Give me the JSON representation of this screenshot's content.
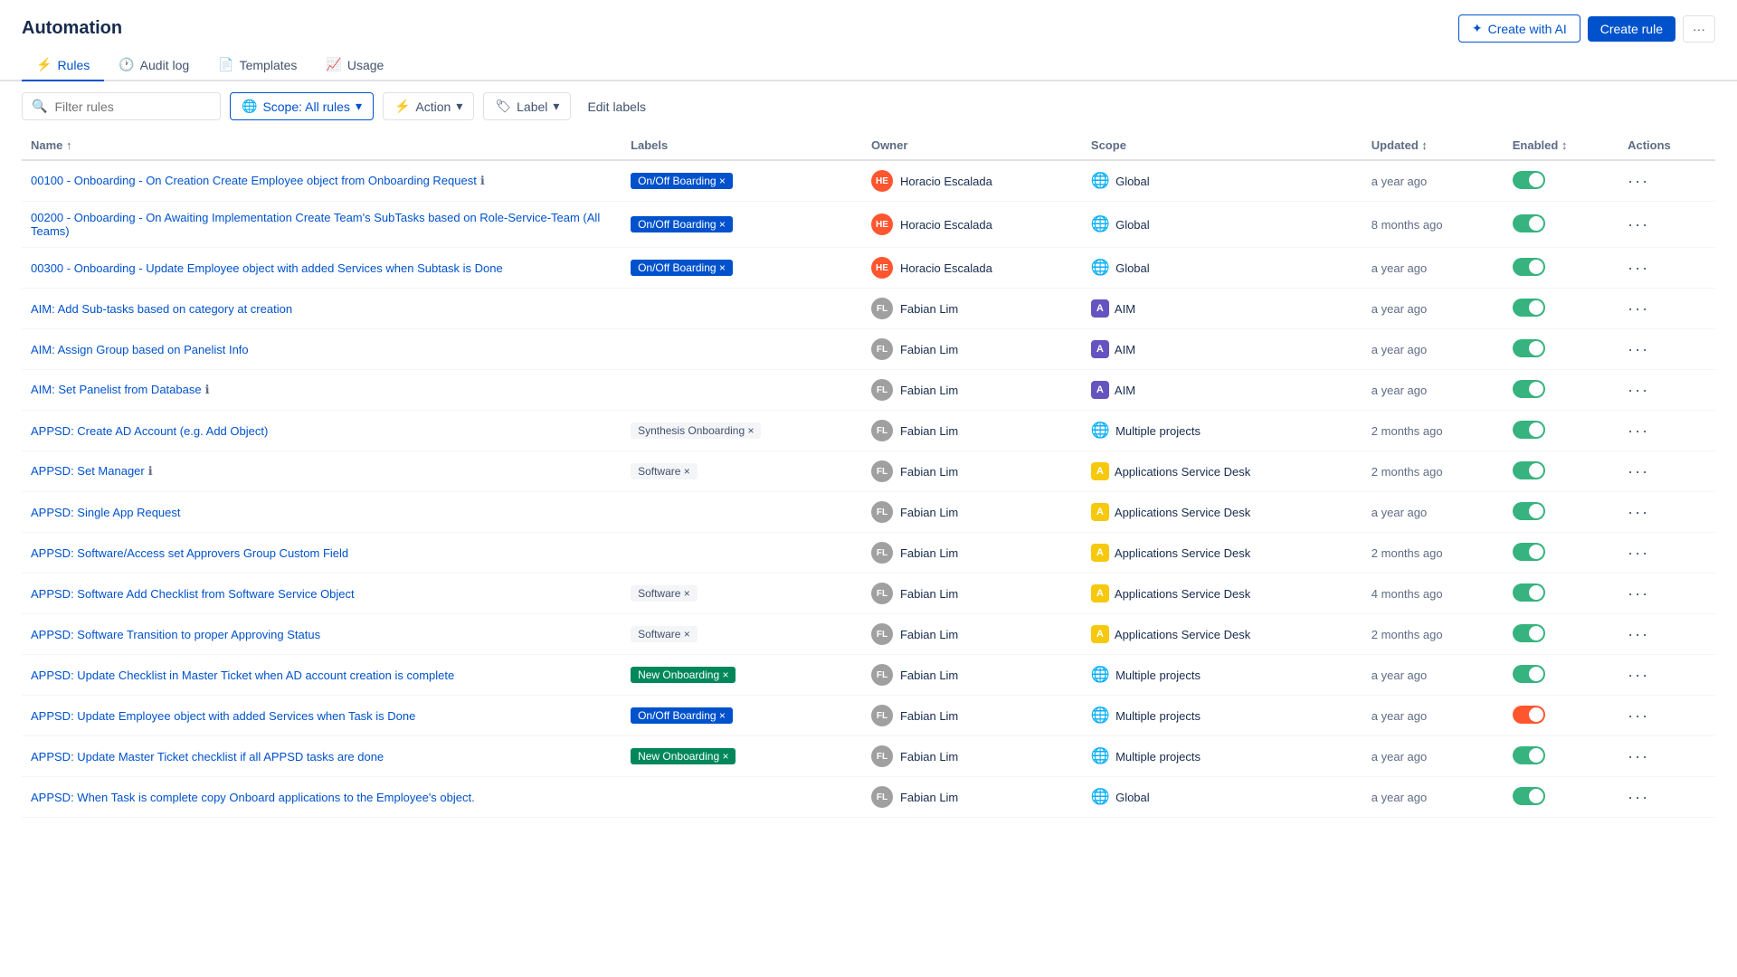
{
  "header": {
    "title": "Automation",
    "btn_create_ai": "Create with AI",
    "btn_create_rule": "Create rule",
    "btn_more_label": "···"
  },
  "tabs": [
    {
      "id": "rules",
      "label": "Rules",
      "icon": "⚡",
      "active": true
    },
    {
      "id": "audit-log",
      "label": "Audit log",
      "icon": "📋",
      "active": false
    },
    {
      "id": "templates",
      "label": "Templates",
      "icon": "📄",
      "active": false
    },
    {
      "id": "usage",
      "label": "Usage",
      "icon": "📈",
      "active": false
    }
  ],
  "toolbar": {
    "search_placeholder": "Filter rules",
    "scope_btn": "Scope: All rules",
    "action_btn": "Action",
    "label_btn": "Label",
    "edit_labels_btn": "Edit labels"
  },
  "table": {
    "columns": [
      "Name ↑",
      "Labels",
      "Owner",
      "Scope",
      "Updated ↕",
      "Enabled ↕",
      "Actions"
    ],
    "rows": [
      {
        "name": "00100 - Onboarding - On Creation Create Employee object from Onboarding Request",
        "note": "ℹ",
        "labels": [
          {
            "text": "On/Off Boarding ×",
            "type": "onoffboarding"
          }
        ],
        "owner_initials": "HE",
        "owner_name": "Horacio Escalada",
        "owner_type": "he",
        "scope_icon": "🌐",
        "scope": "Global",
        "updated": "a year ago",
        "enabled": true,
        "toggle_type": "on"
      },
      {
        "name": "00200 - Onboarding - On Awaiting Implementation Create Team's SubTasks based on Role-Service-Team (All Teams)",
        "note": "",
        "labels": [
          {
            "text": "On/Off Boarding ×",
            "type": "onoffboarding"
          }
        ],
        "owner_initials": "HE",
        "owner_name": "Horacio Escalada",
        "owner_type": "he",
        "scope_icon": "🌐",
        "scope": "Global",
        "updated": "8 months ago",
        "enabled": true,
        "toggle_type": "on"
      },
      {
        "name": "00300 - Onboarding - Update Employee object with added Services when Subtask is Done",
        "note": "",
        "labels": [
          {
            "text": "On/Off Boarding ×",
            "type": "onoffboarding"
          }
        ],
        "owner_initials": "HE",
        "owner_name": "Horacio Escalada",
        "owner_type": "he",
        "scope_icon": "🌐",
        "scope": "Global",
        "updated": "a year ago",
        "enabled": true,
        "toggle_type": "on"
      },
      {
        "name": "AIM: Add Sub-tasks based on category at creation",
        "note": "",
        "labels": [],
        "owner_initials": "FL",
        "owner_name": "Fabian Lim",
        "owner_type": "fl",
        "scope_icon": "🎯",
        "scope": "AIM",
        "updated": "a year ago",
        "enabled": true,
        "toggle_type": "on"
      },
      {
        "name": "AIM: Assign Group based on Panelist Info",
        "note": "",
        "labels": [],
        "owner_initials": "FL",
        "owner_name": "Fabian Lim",
        "owner_type": "fl",
        "scope_icon": "🎯",
        "scope": "AIM",
        "updated": "a year ago",
        "enabled": true,
        "toggle_type": "on"
      },
      {
        "name": "AIM: Set Panelist from Database",
        "note": "ℹ",
        "labels": [],
        "owner_initials": "FL",
        "owner_name": "Fabian Lim",
        "owner_type": "fl",
        "scope_icon": "🎯",
        "scope": "AIM",
        "updated": "a year ago",
        "enabled": true,
        "toggle_type": "on"
      },
      {
        "name": "APPSD: Create AD Account (e.g. Add Object)",
        "note": "",
        "labels": [
          {
            "text": "Synthesis Onboarding ×",
            "type": "synthesis"
          }
        ],
        "owner_initials": "FL",
        "owner_name": "Fabian Lim",
        "owner_type": "fl",
        "scope_icon": "🌐",
        "scope": "Multiple projects",
        "updated": "2 months ago",
        "enabled": true,
        "toggle_type": "on"
      },
      {
        "name": "APPSD: Set Manager",
        "note": "ℹ",
        "labels": [
          {
            "text": "Software ×",
            "type": "software"
          }
        ],
        "owner_initials": "FL",
        "owner_name": "Fabian Lim",
        "owner_type": "fl",
        "scope_icon": "🟡",
        "scope": "Applications Service Desk",
        "updated": "2 months ago",
        "enabled": true,
        "toggle_type": "on"
      },
      {
        "name": "APPSD: Single App Request",
        "note": "",
        "labels": [],
        "owner_initials": "FL",
        "owner_name": "Fabian Lim",
        "owner_type": "fl",
        "scope_icon": "🟡",
        "scope": "Applications Service Desk",
        "updated": "a year ago",
        "enabled": true,
        "toggle_type": "on"
      },
      {
        "name": "APPSD: Software/Access set Approvers Group Custom Field",
        "note": "",
        "labels": [],
        "owner_initials": "FL",
        "owner_name": "Fabian Lim",
        "owner_type": "fl",
        "scope_icon": "🟡",
        "scope": "Applications Service Desk",
        "updated": "2 months ago",
        "enabled": true,
        "toggle_type": "on"
      },
      {
        "name": "APPSD: Software Add Checklist from Software Service Object",
        "note": "",
        "labels": [
          {
            "text": "Software ×",
            "type": "software"
          }
        ],
        "owner_initials": "FL",
        "owner_name": "Fabian Lim",
        "owner_type": "fl",
        "scope_icon": "🟡",
        "scope": "Applications Service Desk",
        "updated": "4 months ago",
        "enabled": true,
        "toggle_type": "on"
      },
      {
        "name": "APPSD: Software Transition to proper Approving Status",
        "note": "",
        "labels": [
          {
            "text": "Software ×",
            "type": "software"
          }
        ],
        "owner_initials": "FL",
        "owner_name": "Fabian Lim",
        "owner_type": "fl",
        "scope_icon": "🟡",
        "scope": "Applications Service Desk",
        "updated": "2 months ago",
        "enabled": true,
        "toggle_type": "on"
      },
      {
        "name": "APPSD: Update Checklist in Master Ticket when AD account creation is complete",
        "note": "",
        "labels": [
          {
            "text": "New Onboarding ×",
            "type": "new-onboarding"
          }
        ],
        "owner_initials": "FL",
        "owner_name": "Fabian Lim",
        "owner_type": "fl",
        "scope_icon": "🌐",
        "scope": "Multiple projects",
        "updated": "a year ago",
        "enabled": true,
        "toggle_type": "on"
      },
      {
        "name": "APPSD: Update Employee object with added Services when Task is Done",
        "note": "",
        "labels": [
          {
            "text": "On/Off Boarding ×",
            "type": "onoffboarding"
          }
        ],
        "owner_initials": "FL",
        "owner_name": "Fabian Lim",
        "owner_type": "fl",
        "scope_icon": "🌐",
        "scope": "Multiple projects",
        "updated": "a year ago",
        "enabled": false,
        "toggle_type": "off-red"
      },
      {
        "name": "APPSD: Update Master Ticket checklist if all APPSD tasks are done",
        "note": "",
        "labels": [
          {
            "text": "New Onboarding ×",
            "type": "new-onboarding"
          }
        ],
        "owner_initials": "FL",
        "owner_name": "Fabian Lim",
        "owner_type": "fl",
        "scope_icon": "🌐",
        "scope": "Multiple projects",
        "updated": "a year ago",
        "enabled": true,
        "toggle_type": "on"
      },
      {
        "name": "APPSD: When Task is complete copy Onboard applications to the Employee's object.",
        "note": "",
        "labels": [],
        "owner_initials": "FL",
        "owner_name": "Fabian Lim",
        "owner_type": "fl",
        "scope_icon": "🌐",
        "scope": "Global",
        "updated": "a year ago",
        "enabled": true,
        "toggle_type": "on"
      }
    ]
  }
}
